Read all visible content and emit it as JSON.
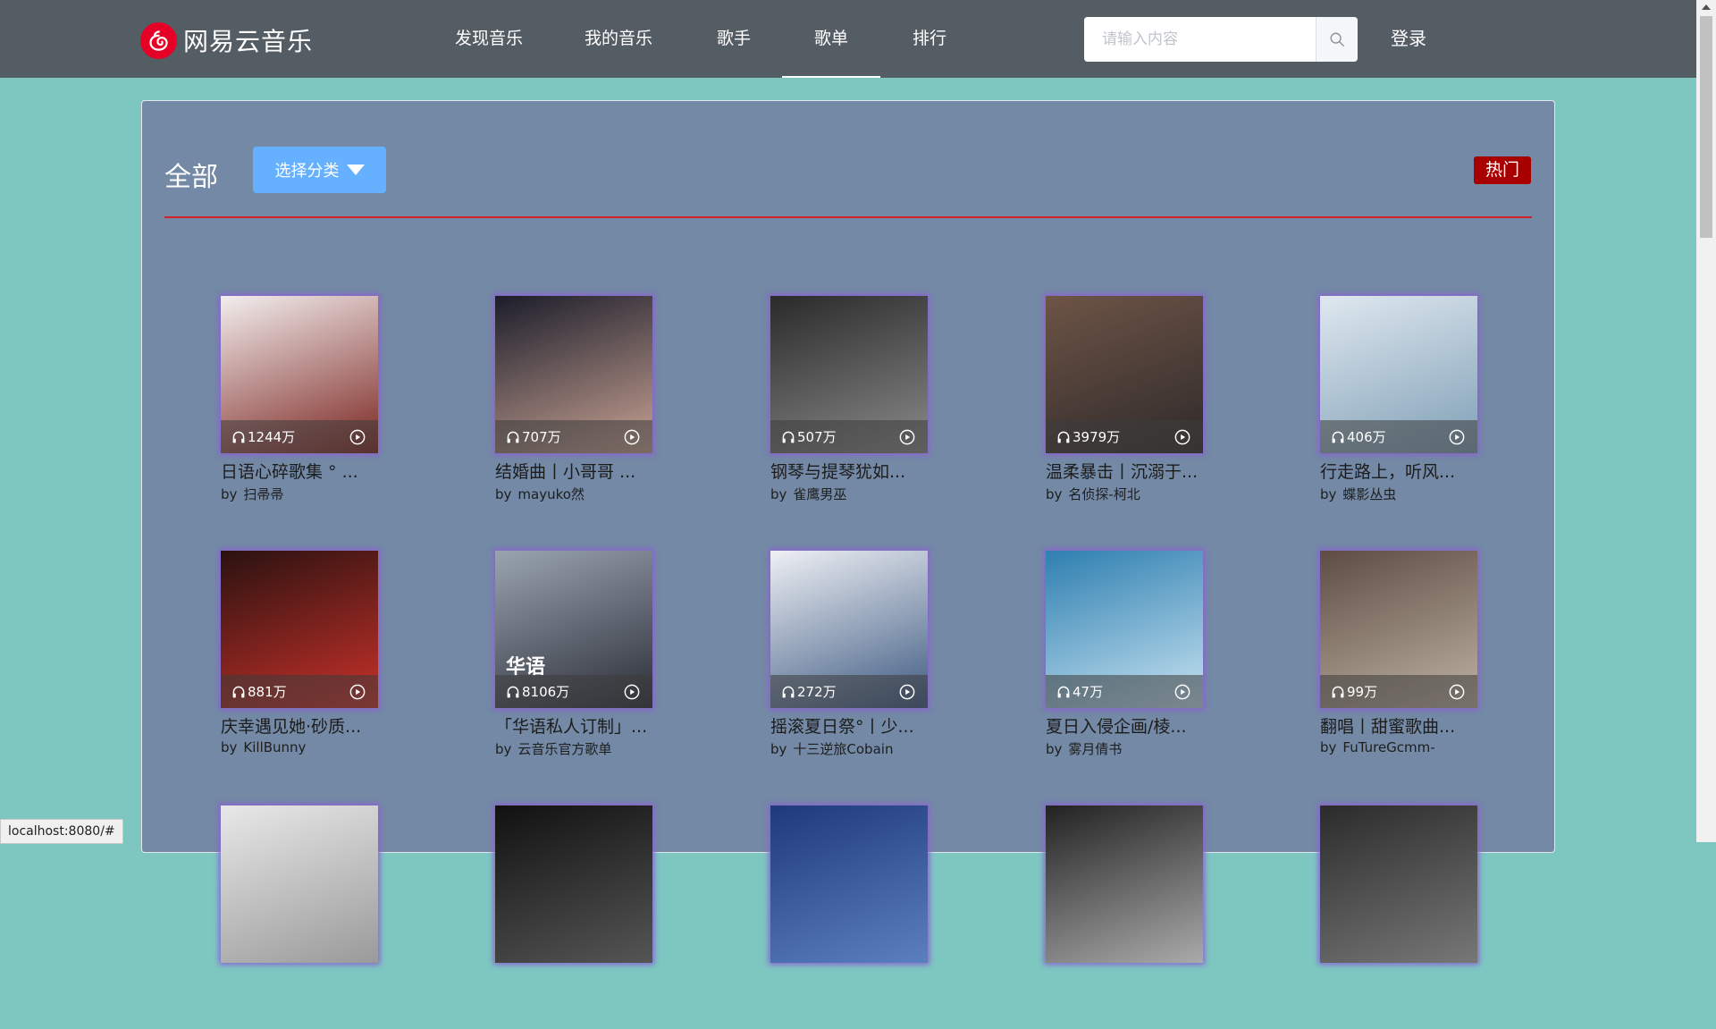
{
  "brand": {
    "name": "网易云音乐",
    "accent": "#e60026"
  },
  "nav": {
    "items": [
      {
        "label": "发现音乐"
      },
      {
        "label": "我的音乐"
      },
      {
        "label": "歌手"
      },
      {
        "label": "歌单",
        "active": true
      },
      {
        "label": "排行"
      }
    ]
  },
  "search": {
    "placeholder": "请输入内容",
    "value": "",
    "icon": "search-icon"
  },
  "login_label": "登录",
  "panel": {
    "title": "全部",
    "category_button": "选择分类",
    "hot_tag": "热门"
  },
  "playlists": [
    {
      "title": "日语心碎歌集 ° ...",
      "author": "扫帚帚",
      "plays": "1244万",
      "cover": [
        "#f2eeee",
        "#7b2520"
      ]
    },
    {
      "title": "结婚曲丨小哥哥 ...",
      "author": "mayuko然",
      "plays": "707万",
      "cover": [
        "#1b1d2a",
        "#c9a394"
      ]
    },
    {
      "title": "钢琴与提琴犹如...",
      "author": "雀鹰男巫",
      "plays": "507万",
      "cover": [
        "#2a2a2a",
        "#8a8a8a"
      ]
    },
    {
      "title": "温柔暴击丨沉溺于...",
      "author": "名侦探-柯北",
      "plays": "3979万",
      "cover": [
        "#6d5446",
        "#2f2a2a"
      ]
    },
    {
      "title": "行走路上，听风...",
      "author": "蝶影丛虫",
      "plays": "406万",
      "cover": [
        "#dfe8ef",
        "#7f9fb6"
      ]
    },
    {
      "title": "庆幸遇见她·砂质...",
      "author": "KillBunny",
      "plays": "881万",
      "cover": [
        "#2a1210",
        "#c9312a"
      ]
    },
    {
      "title": "「华语私人订制」...",
      "author": "云音乐官方歌单",
      "plays": "8106万",
      "cover": [
        "#9aa4b1",
        "#2a2d36"
      ],
      "badge": "华语"
    },
    {
      "title": "摇滚夏日祭°丨少...",
      "author": "十三逆旅Cobain",
      "plays": "272万",
      "cover": [
        "#eef0f4",
        "#3e5a82"
      ]
    },
    {
      "title": "夏日入侵企画/棱...",
      "author": "雾月倩书",
      "plays": "47万",
      "cover": [
        "#2e7fb0",
        "#c7e3f1"
      ]
    },
    {
      "title": "翻唱丨甜蜜歌曲...",
      "author": "FuTureGcmm-",
      "plays": "99万",
      "cover": [
        "#5e4c44",
        "#bfb3a3"
      ]
    },
    {
      "title": "",
      "author": "",
      "plays": "",
      "cover": [
        "#e8e8e8",
        "#9a9a9a"
      ]
    },
    {
      "title": "",
      "author": "",
      "plays": "",
      "cover": [
        "#111111",
        "#555555"
      ]
    },
    {
      "title": "",
      "author": "",
      "plays": "",
      "cover": [
        "#1e3a7a",
        "#5c7fc0"
      ]
    },
    {
      "title": "",
      "author": "",
      "plays": "",
      "cover": [
        "#222222",
        "#aaaaaa"
      ]
    },
    {
      "title": "",
      "author": "",
      "plays": "",
      "cover": [
        "#2b2b2b",
        "#777777"
      ]
    }
  ],
  "author_prefix": "by",
  "status_url": "localhost:8080/#"
}
